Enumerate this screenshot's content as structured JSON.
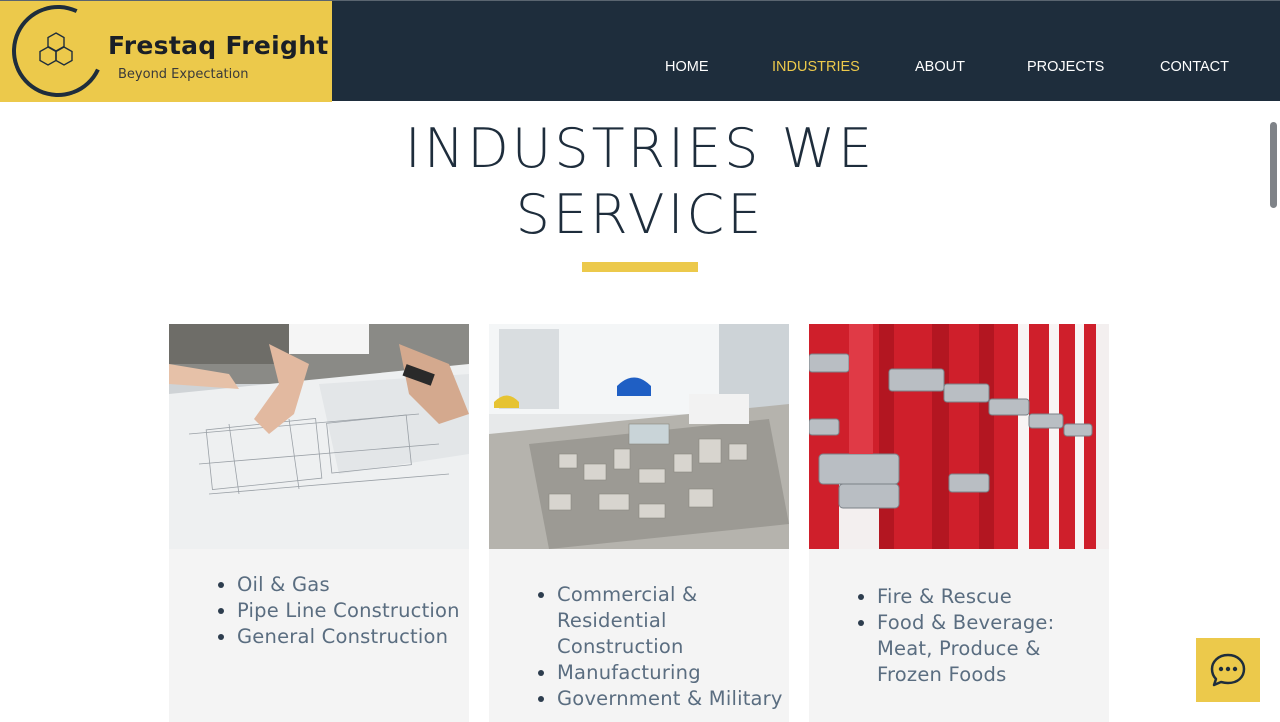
{
  "brand": {
    "name": "Frestaq Freight",
    "tagline": "Beyond Expectation",
    "logo_icon": "hexagon-logo-icon"
  },
  "nav": {
    "items": [
      {
        "label": "HOME",
        "active": false
      },
      {
        "label": "INDUSTRIES",
        "active": true
      },
      {
        "label": "ABOUT",
        "active": false
      },
      {
        "label": "PROJECTS",
        "active": false
      },
      {
        "label": "CONTACT",
        "active": false
      }
    ]
  },
  "main": {
    "title_line1": "INDUSTRIES WE",
    "title_line2": "SERVICE"
  },
  "cards": [
    {
      "image": "blueprint-photo",
      "items": [
        "Oil & Gas",
        "Pipe Line Construction",
        "General Construction"
      ]
    },
    {
      "image": "architecture-model-photo",
      "items": [
        "Commercial & Residential Construction",
        "Manufacturing",
        "Government & Military"
      ]
    },
    {
      "image": "fire-hoses-photo",
      "items": [
        "Fire & Rescue",
        "Food & Beverage: Meat, Produce & Frozen Foods"
      ]
    }
  ],
  "chat": {
    "icon": "chat-bubble-icon"
  },
  "colors": {
    "header_bg": "#1e2d3c",
    "accent": "#ecc94b",
    "card_bg": "#f4f4f4",
    "list_text": "#5a6d80",
    "title_text": "#1e2d3c"
  }
}
